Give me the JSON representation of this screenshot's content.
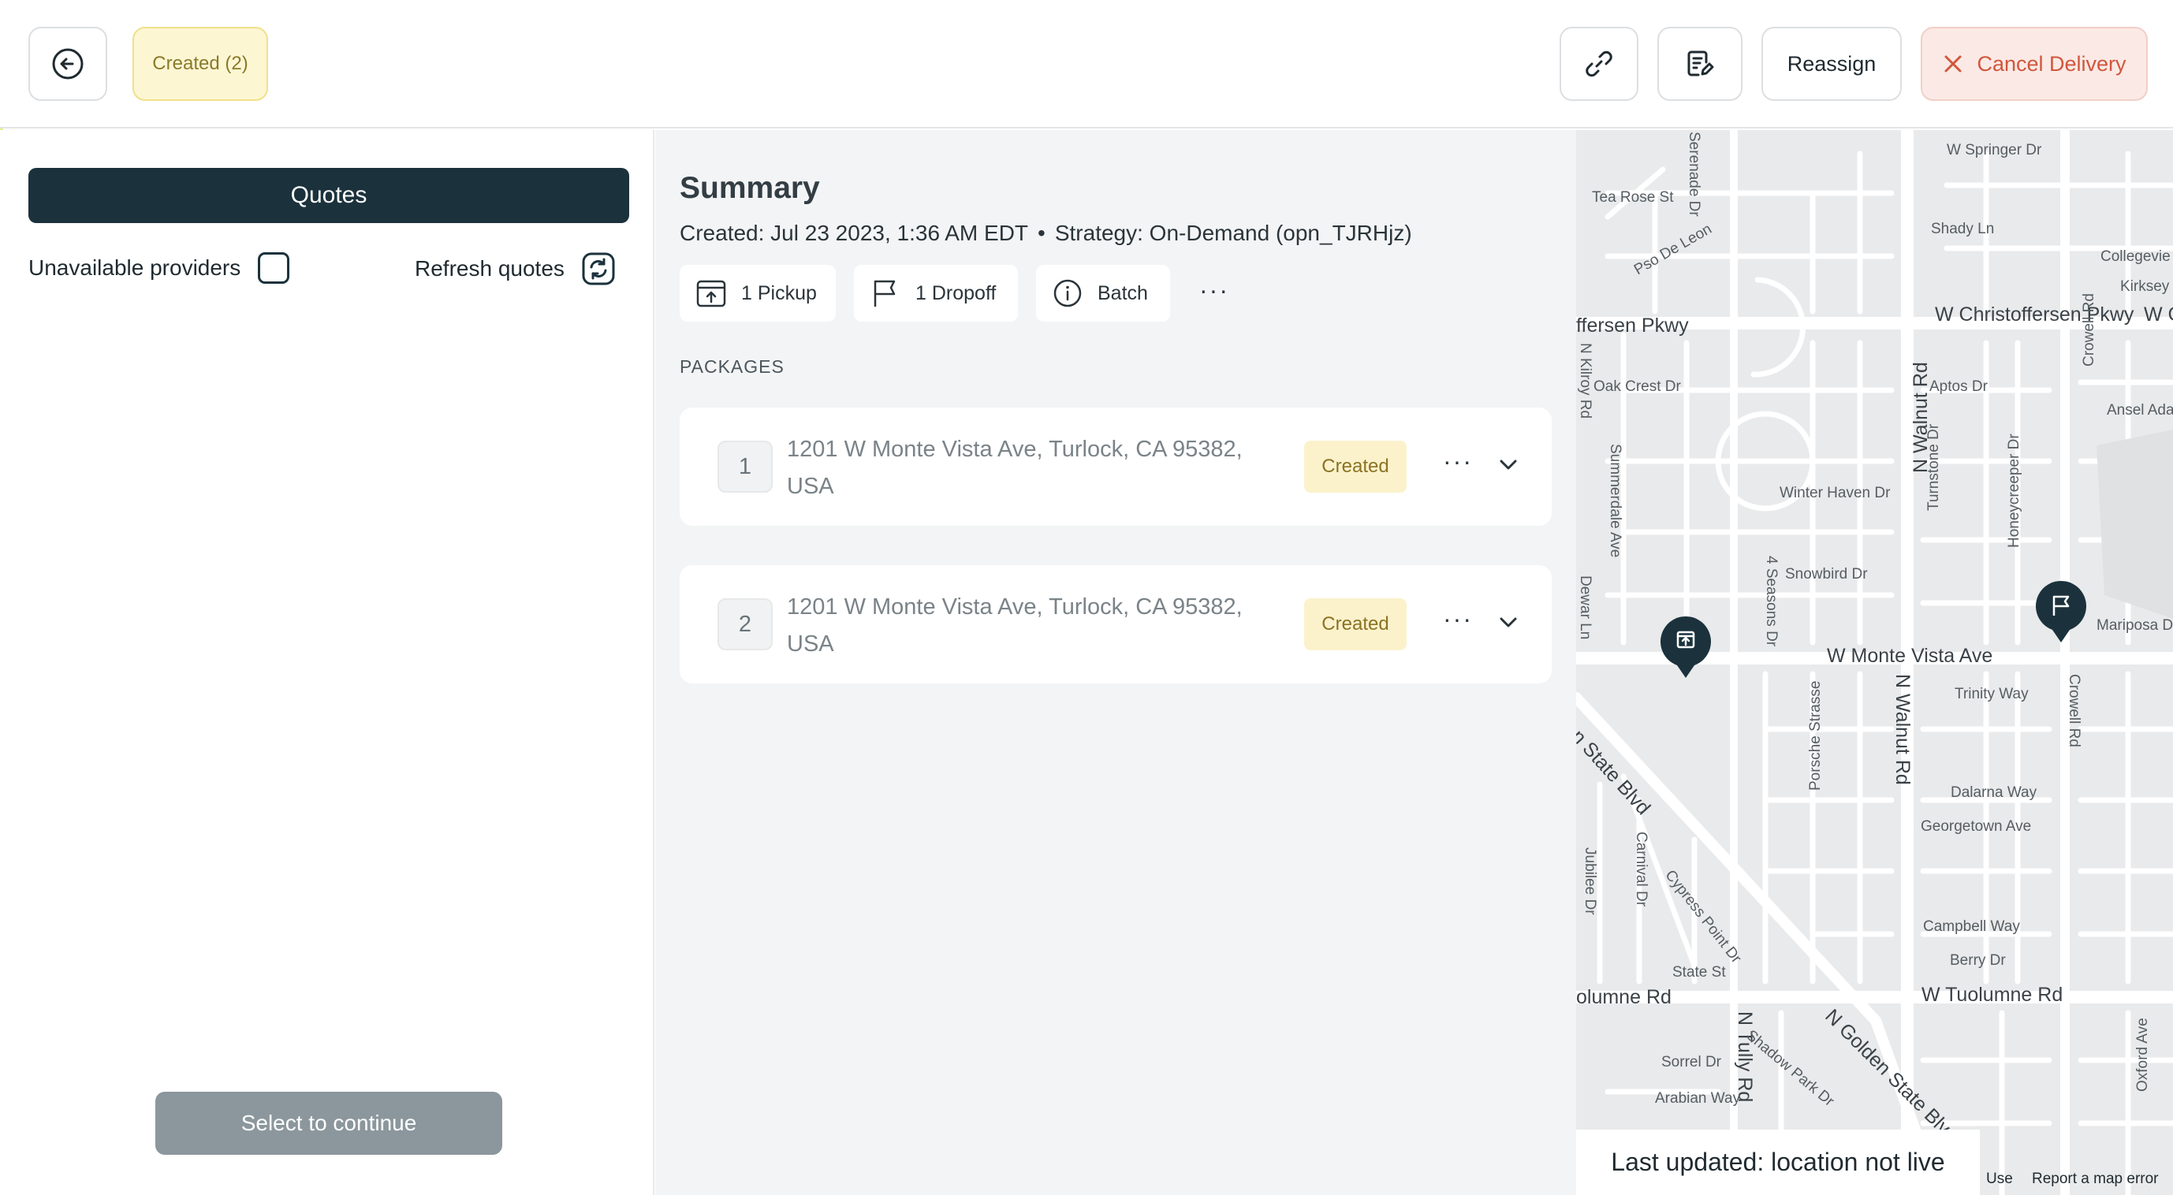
{
  "header": {
    "back_icon": "arrow-left-circle-icon",
    "status_label": "Created (2)",
    "link_icon": "link-icon",
    "note_icon": "edit-note-icon",
    "reassign_label": "Reassign",
    "cancel_label": "Cancel Delivery",
    "cancel_icon": "close-icon",
    "cancel_color": "#d0573c"
  },
  "left_panel": {
    "quotes_label": "Quotes",
    "unavailable_label": "Unavailable providers",
    "unavailable_checked": false,
    "refresh_label": "Refresh quotes",
    "refresh_icon": "refresh-icon",
    "continue_label": "Select to continue"
  },
  "summary": {
    "title": "Summary",
    "created": "Created: Jul 23 2023, 1:36 AM EDT",
    "separator": "•",
    "strategy": "Strategy: On-Demand (opn_TJRHjz)",
    "chips": {
      "pickup": "1 Pickup",
      "dropoff": "1 Dropoff",
      "batch": "Batch"
    },
    "more": "···",
    "packages_label": "PACKAGES",
    "packages": [
      {
        "num": "1",
        "address": "1201 W Monte Vista Ave, Turlock, CA 95382, USA",
        "status": "Created"
      },
      {
        "num": "2",
        "address": "1201 W Monte Vista Ave, Turlock, CA 95382, USA",
        "status": "Created"
      }
    ]
  },
  "map": {
    "last_updated": "Last updated: location not live",
    "attrib_terms": "Use",
    "attrib_report": "Report a map error",
    "labels": {
      "springer": "W Springer Dr",
      "tea_rose": "Tea Rose St",
      "serenade": "Serenade Dr",
      "shady": "Shady Ln",
      "pso_de_leon": "Pso De Leon",
      "collegeview": "Collegevie",
      "kirksey": "Kirksey",
      "christoffersen_left": "ffersen Pkwy",
      "christoffersen": "W Christoffersen Pkwy",
      "w_c": "W C",
      "oak_crest": "Oak Crest Dr",
      "aptos": "Aptos Dr",
      "ansel_adams": "Ansel Adar",
      "crowell_top": "Crowell Rd",
      "n_walnut_top": "N Walnut Rd",
      "summerdale": "Summerdale Ave",
      "winter_haven": "Winter Haven Dr",
      "turnstone": "Turnstone Dr",
      "honeycreeper": "Honeycreeper Dr",
      "snowbird": "Snowbird Dr",
      "four_seasons": "4 Seasons Dr",
      "dewar": "Dewar Ln",
      "mariposa": "Mariposa D",
      "monte_vista": "W Monte Vista Ave",
      "trinity": "Trinity Way",
      "crowell_mid": "Crowell Rd",
      "porsche": "Porsche Strasse",
      "n_walnut_mid": "N Walnut Rd",
      "golden_state_top": "en State Blvd",
      "dalarna": "Dalarna Way",
      "georgetown": "Georgetown Ave",
      "carnival": "Carnival Dr",
      "jubilee": "Jubilee Dr",
      "cypress_point": "Cypress Point Dr",
      "campbell": "Campbell Way",
      "berry": "Berry Dr",
      "state_st": "State St",
      "tuolumne_left": "olumne Rd",
      "tuolumne": "W Tuolumne Rd",
      "n_tully": "N Tully Rd",
      "shadow_park": "Shadow Park Dr",
      "golden_state_bottom": "N Golden State Blvd",
      "oxford": "Oxford Ave",
      "sorrel": "Sorrel Dr",
      "arabian": "Arabian Way",
      "n_kilroy": "N Kilroy Rd"
    }
  }
}
